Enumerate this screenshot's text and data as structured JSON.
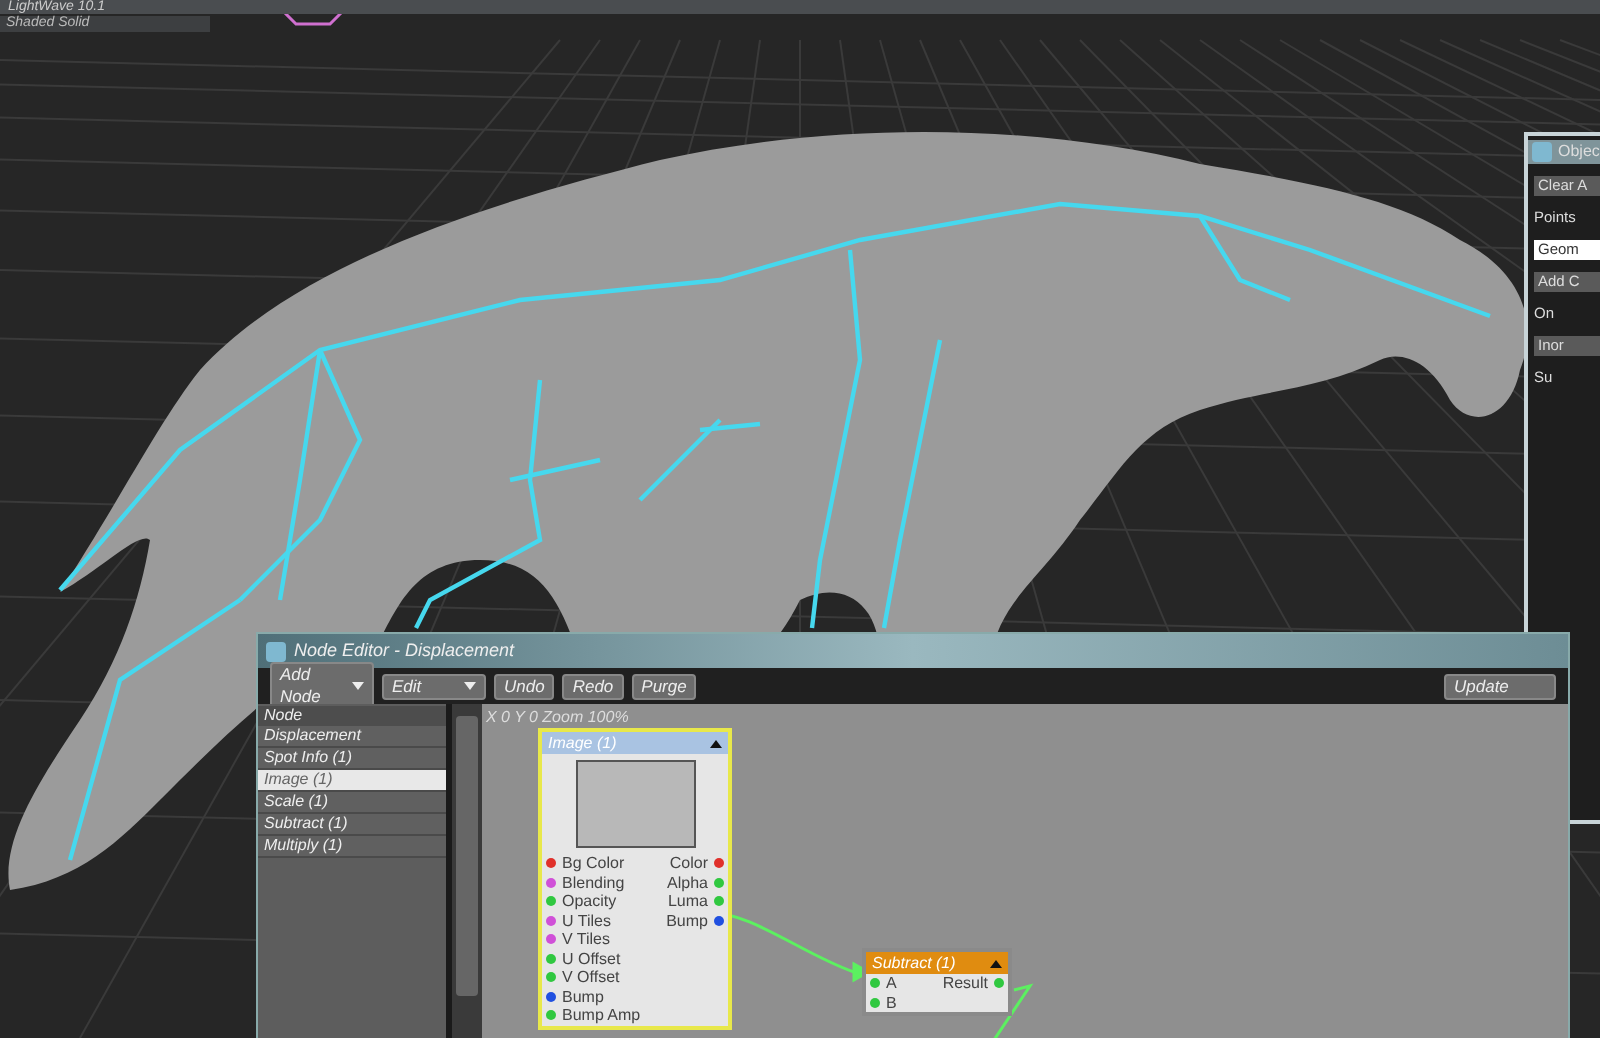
{
  "app": {
    "title": "LightWave 10.1",
    "view_mode": "Shaded Solid"
  },
  "node_editor": {
    "title": "Node Editor - Displacement",
    "toolbar": [
      {
        "label": "Add Node",
        "kind": "dropdown"
      },
      {
        "label": "Edit",
        "kind": "dropdown"
      },
      {
        "label": "Undo",
        "kind": "button"
      },
      {
        "label": "Redo",
        "kind": "button"
      },
      {
        "label": "Purge",
        "kind": "button"
      }
    ],
    "update_button": "Update",
    "status": "X 0 Y 0 Zoom 100%",
    "node_list": {
      "header": "Node",
      "items": [
        {
          "label": "Displacement",
          "selected": false
        },
        {
          "label": "Spot Info (1)",
          "selected": false
        },
        {
          "label": "Image (1)",
          "selected": true
        },
        {
          "label": "Scale (1)",
          "selected": false
        },
        {
          "label": "Subtract (1)",
          "selected": false
        },
        {
          "label": "Multiply (1)",
          "selected": false
        }
      ]
    },
    "nodes": [
      {
        "title": "Image (1)",
        "color": "#a9c3e2",
        "selected": true,
        "preview": true,
        "inputs": [
          {
            "label": "Bg Color",
            "color": "#e0302a"
          },
          {
            "label": "Blending",
            "color": "#d050d8"
          },
          {
            "label": "Opacity",
            "color": "#30c840"
          },
          {
            "label": "U Tiles",
            "color": "#d050d8"
          },
          {
            "label": "V Tiles",
            "color": "#d050d8"
          },
          {
            "label": "U Offset",
            "color": "#30c840"
          },
          {
            "label": "V Offset",
            "color": "#30c840"
          },
          {
            "label": "Bump",
            "color": "#2050e0"
          },
          {
            "label": "Bump Amp",
            "color": "#30c840"
          }
        ],
        "outputs": [
          {
            "label": "Color",
            "color": "#e0302a"
          },
          {
            "label": "Alpha",
            "color": "#30c840"
          },
          {
            "label": "Luma",
            "color": "#30c840"
          },
          {
            "label": "Bump",
            "color": "#2050e0"
          }
        ]
      },
      {
        "title": "Subtract (1)",
        "color": "#e08c10",
        "selected": false,
        "preview": false,
        "inputs": [
          {
            "label": "A",
            "color": "#30c840"
          },
          {
            "label": "B",
            "color": "#30c840"
          }
        ],
        "outputs": [
          {
            "label": "Result",
            "color": "#30c840"
          }
        ]
      }
    ]
  },
  "object_panel": {
    "title": "Objec",
    "items": [
      {
        "kind": "button",
        "label": "Clear A"
      },
      {
        "kind": "label",
        "label": "Points"
      },
      {
        "kind": "field",
        "label": "Geom"
      },
      {
        "kind": "button",
        "label": "Add C"
      },
      {
        "kind": "label",
        "label": "On"
      },
      {
        "kind": "button",
        "label": "Inor"
      },
      {
        "kind": "label",
        "label": "Su"
      }
    ]
  }
}
